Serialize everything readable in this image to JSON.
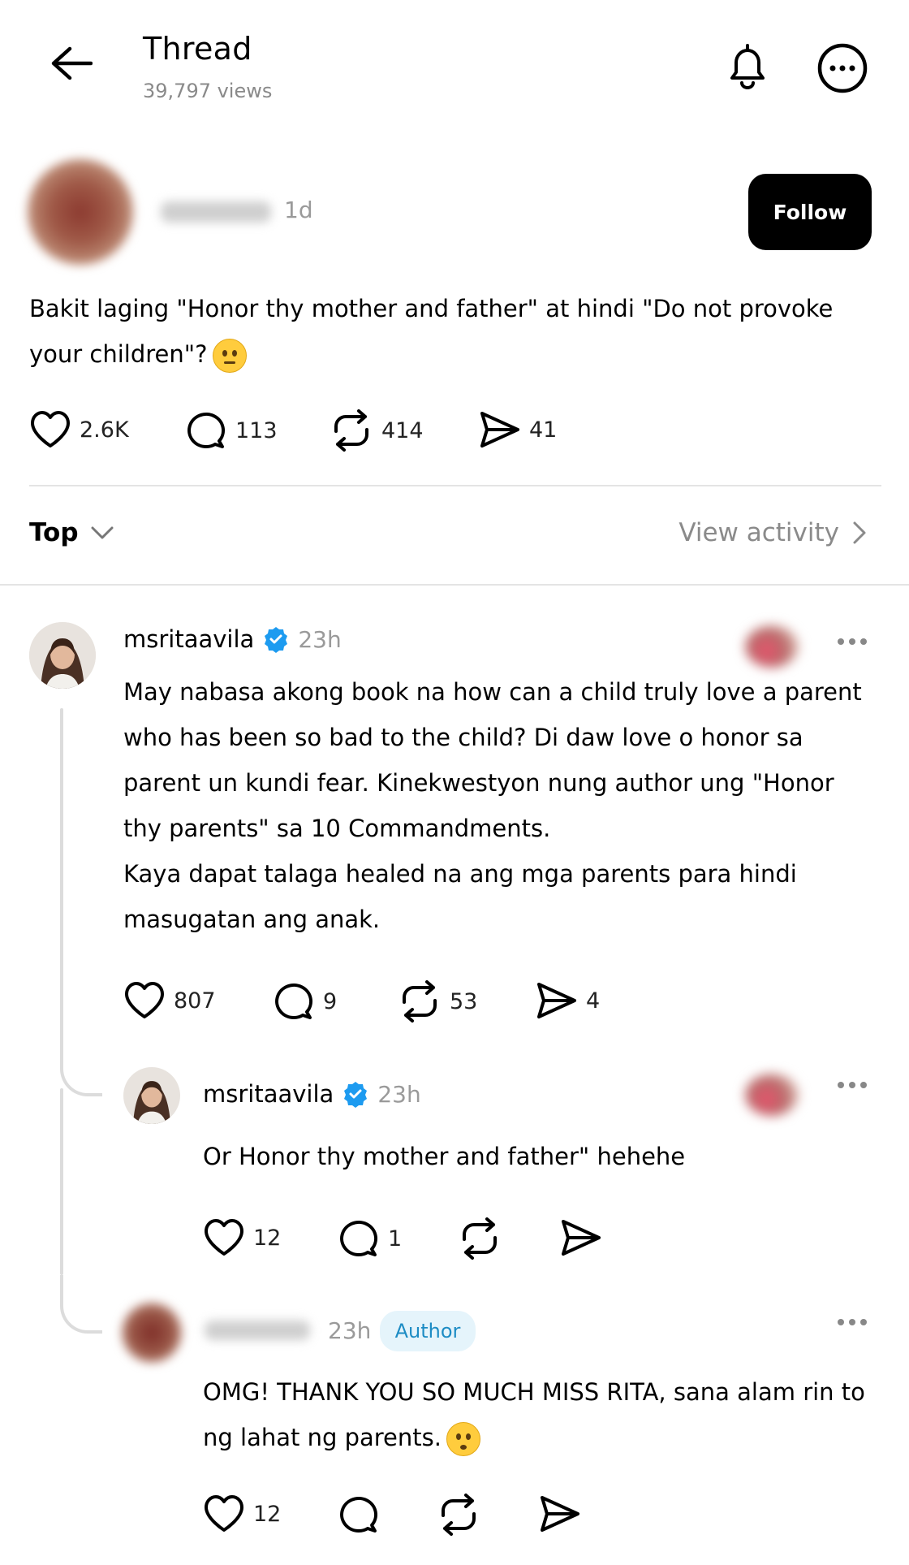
{
  "header": {
    "title": "Thread",
    "views": "39,797 views"
  },
  "post": {
    "time": "1d",
    "follow_label": "Follow",
    "text_line1": "Bakit laging \"Honor thy mother and father\" at hindi \"Do not provoke",
    "text_line2": "your children\"?",
    "emoji": "thinking-face",
    "likes": "2.6K",
    "comments": "113",
    "reposts": "414",
    "shares": "41"
  },
  "sort": {
    "label": "Top",
    "view_activity": "View activity"
  },
  "comment1": {
    "username": "msritaavila",
    "time": "23h",
    "lines": [
      "May nabasa akong book na how can a child truly love a parent",
      "who has been so bad to the child? Di daw love o honor sa",
      "parent un kundi fear. Kinekwestyon nung author ung \"Honor",
      "thy parents\" sa 10 Commandments.",
      "Kaya dapat talaga healed na ang mga parents para hindi",
      "masugatan ang anak."
    ],
    "likes": "807",
    "comments": "9",
    "reposts": "53",
    "shares": "4"
  },
  "comment2": {
    "username": "msritaavila",
    "time": "23h",
    "text": "Or Honor thy mother and father\" hehehe",
    "likes": "12",
    "comments": "1"
  },
  "comment3": {
    "time": "23h",
    "badge": "Author",
    "line1": "OMG! THANK YOU SO MUCH MISS RITA, sana alam rin to",
    "line2": "ng lahat ng parents.",
    "emoji": "pleading-face",
    "likes": "12"
  },
  "colors": {
    "verified": "#1d9bf0",
    "author_badge_bg": "#e5f4fb",
    "author_badge_text": "#1d8cc4",
    "follow_bg": "#000000"
  }
}
